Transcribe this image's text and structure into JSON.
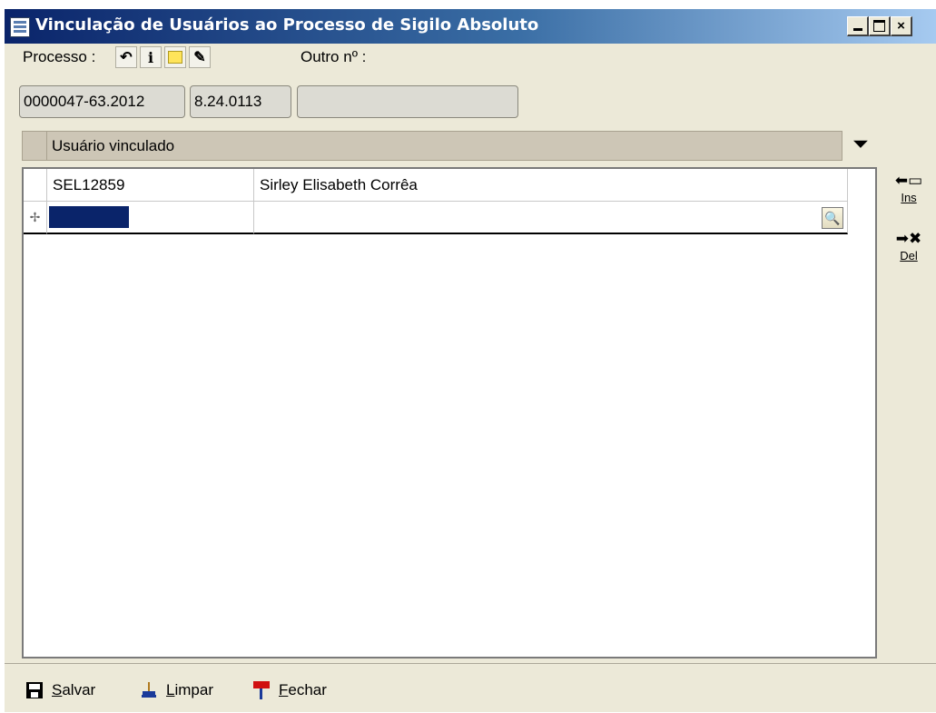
{
  "window": {
    "title": "Vinculação de Usuários ao Processo de Sigilo Absoluto",
    "controls": {
      "minimize": "_",
      "maximize": "□",
      "close": "×"
    }
  },
  "process": {
    "label": "Processo :",
    "outro_label": "Outro nº :",
    "number_part1": "0000047-63.2012",
    "number_part2": "8.24.0113",
    "outro_value": "",
    "toolbar_icons": [
      "undo-icon",
      "info-icon",
      "note-icon",
      "tag-icon"
    ]
  },
  "grid": {
    "header": "Usuário vinculado",
    "rows": [
      {
        "code": "SEL12859",
        "name": "Sirley Elisabeth Corrêa"
      },
      {
        "code": "",
        "name": ""
      }
    ],
    "new_row_marker": "✢"
  },
  "side_actions": {
    "insert_label": "Ins",
    "delete_label": "Del"
  },
  "footer": {
    "save_first": "S",
    "save_rest": "alvar",
    "clear_first": "L",
    "clear_rest": "impar",
    "close_first": "F",
    "close_rest": "echar"
  },
  "colors": {
    "title_gradient_start": "#0a246a",
    "title_gradient_end": "#a6caf0",
    "window_bg": "#ece9d8",
    "selection": "#0a246a",
    "header_bg": "#cdc6b6"
  }
}
